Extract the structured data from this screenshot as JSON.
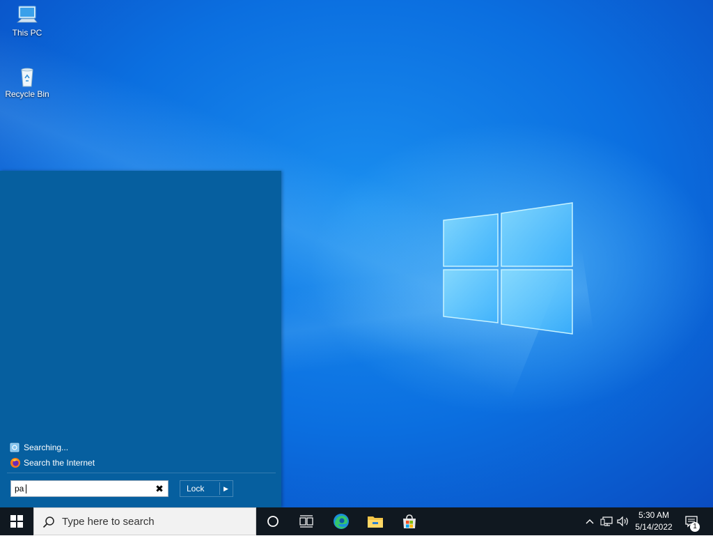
{
  "desktop": {
    "icons": [
      {
        "name": "this-pc",
        "label": "This PC",
        "icon": "computer-icon"
      },
      {
        "name": "recycle-bin",
        "label": "Recycle Bin",
        "icon": "recycle-bin-icon"
      }
    ],
    "accent_color": "#0b6fe0"
  },
  "start_menu": {
    "background_color": "#065f9f",
    "results": [
      {
        "label": "Searching...",
        "icon": "search-progress-icon"
      },
      {
        "label": "Search the Internet",
        "icon": "firefox-icon"
      }
    ],
    "search_value": "pa",
    "lock_label": "Lock"
  },
  "taskbar": {
    "background_color": "#101820",
    "search_placeholder": "Type here to search",
    "pinned": [
      "cortana-icon",
      "task-view-icon",
      "edge-icon",
      "file-explorer-icon",
      "store-icon"
    ],
    "tray_icons": [
      "chevron-up-icon",
      "network-icon",
      "volume-icon"
    ],
    "time": "5:30 AM",
    "date": "5/14/2022",
    "notification_count": "1"
  }
}
